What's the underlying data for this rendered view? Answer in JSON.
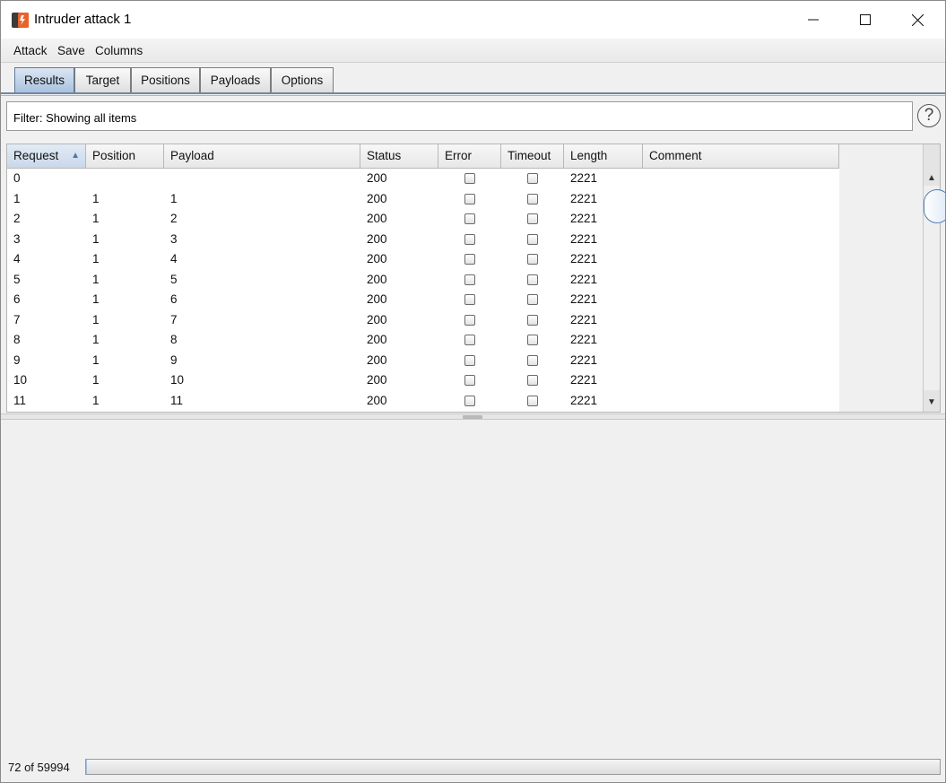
{
  "window": {
    "title": "Intruder attack 1",
    "icon": "burp-intruder-icon",
    "controls": [
      "minimize-icon",
      "maximize-icon",
      "close-icon"
    ]
  },
  "menu": {
    "items": [
      "Attack",
      "Save",
      "Columns"
    ]
  },
  "tabs": {
    "items": [
      {
        "label": "Results",
        "active": true
      },
      {
        "label": "Target",
        "active": false
      },
      {
        "label": "Positions",
        "active": false
      },
      {
        "label": "Payloads",
        "active": false
      },
      {
        "label": "Options",
        "active": false
      }
    ]
  },
  "filter": {
    "text": "Filter: Showing all items",
    "help_icon": "help-icon",
    "help_glyph": "?"
  },
  "table": {
    "columns": [
      "Request",
      "Position",
      "Payload",
      "Status",
      "Error",
      "Timeout",
      "Length",
      "Comment"
    ],
    "sorted_column": "Request",
    "sort_direction": "ascending",
    "sort_glyph": "▲",
    "rows": [
      {
        "request": "0",
        "position": "",
        "payload": "",
        "status": "200",
        "error": false,
        "timeout": false,
        "length": "2221",
        "comment": ""
      },
      {
        "request": "1",
        "position": "1",
        "payload": "1",
        "status": "200",
        "error": false,
        "timeout": false,
        "length": "2221",
        "comment": ""
      },
      {
        "request": "2",
        "position": "1",
        "payload": "2",
        "status": "200",
        "error": false,
        "timeout": false,
        "length": "2221",
        "comment": ""
      },
      {
        "request": "3",
        "position": "1",
        "payload": "3",
        "status": "200",
        "error": false,
        "timeout": false,
        "length": "2221",
        "comment": ""
      },
      {
        "request": "4",
        "position": "1",
        "payload": "4",
        "status": "200",
        "error": false,
        "timeout": false,
        "length": "2221",
        "comment": ""
      },
      {
        "request": "5",
        "position": "1",
        "payload": "5",
        "status": "200",
        "error": false,
        "timeout": false,
        "length": "2221",
        "comment": ""
      },
      {
        "request": "6",
        "position": "1",
        "payload": "6",
        "status": "200",
        "error": false,
        "timeout": false,
        "length": "2221",
        "comment": ""
      },
      {
        "request": "7",
        "position": "1",
        "payload": "7",
        "status": "200",
        "error": false,
        "timeout": false,
        "length": "2221",
        "comment": ""
      },
      {
        "request": "8",
        "position": "1",
        "payload": "8",
        "status": "200",
        "error": false,
        "timeout": false,
        "length": "2221",
        "comment": ""
      },
      {
        "request": "9",
        "position": "1",
        "payload": "9",
        "status": "200",
        "error": false,
        "timeout": false,
        "length": "2221",
        "comment": ""
      },
      {
        "request": "10",
        "position": "1",
        "payload": "10",
        "status": "200",
        "error": false,
        "timeout": false,
        "length": "2221",
        "comment": ""
      },
      {
        "request": "11",
        "position": "1",
        "payload": "11",
        "status": "200",
        "error": false,
        "timeout": false,
        "length": "2221",
        "comment": ""
      }
    ],
    "scroll_up_glyph": "▲",
    "scroll_down_glyph": "▼"
  },
  "status": {
    "count_text": "72 of 59994",
    "progress": 0.0012
  },
  "colors": {
    "accent": "#6f87a6",
    "active_tab": "#a9c2de",
    "icon_orange": "#e8632b",
    "icon_dark": "#3b3b3b"
  }
}
